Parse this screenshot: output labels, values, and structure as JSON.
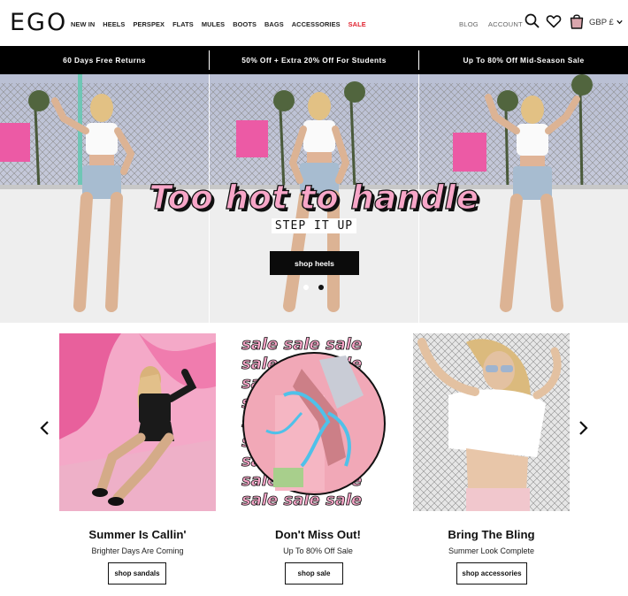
{
  "header": {
    "logo": "EGO",
    "nav": [
      {
        "label": "NEW IN"
      },
      {
        "label": "HEELS"
      },
      {
        "label": "PERSPEX"
      },
      {
        "label": "FLATS"
      },
      {
        "label": "MULES"
      },
      {
        "label": "BOOTS"
      },
      {
        "label": "BAGS"
      },
      {
        "label": "ACCESSORIES"
      },
      {
        "label": "SALE"
      }
    ],
    "blog": "BLOG",
    "account": "ACCOUNT",
    "currency": "GBP £",
    "sale_color": "#e0222f"
  },
  "promo_bar": [
    {
      "text": "60 Days Free Returns"
    },
    {
      "text": "50% Off + Extra 20% Off For Students"
    },
    {
      "text": "Up To 80% Off Mid-Season Sale"
    }
  ],
  "hero": {
    "title": "Too hot to handle",
    "subtitle": "STEP IT UP",
    "cta": "shop heels",
    "title_color": "#f7a6c8",
    "active_slide": 2,
    "slide_count": 2
  },
  "cards": [
    {
      "title": "Summer Is Callin'",
      "subtitle": "Brighter Days Are Coming",
      "button": "shop sandals"
    },
    {
      "title": "Don't Miss Out!",
      "subtitle": "Up To 80% Off Sale",
      "button": "shop sale",
      "image_text": "sale sale sale"
    },
    {
      "title": "Bring The Bling",
      "subtitle": "Summer Look Complete",
      "button": "shop accessories"
    }
  ],
  "icons": {
    "search": "search-icon",
    "wishlist": "heart-icon",
    "bag": "shopping-bag-icon",
    "currency_dropdown": "chevron-down-icon",
    "carousel_prev": "chevron-left-icon",
    "carousel_next": "chevron-right-icon"
  }
}
